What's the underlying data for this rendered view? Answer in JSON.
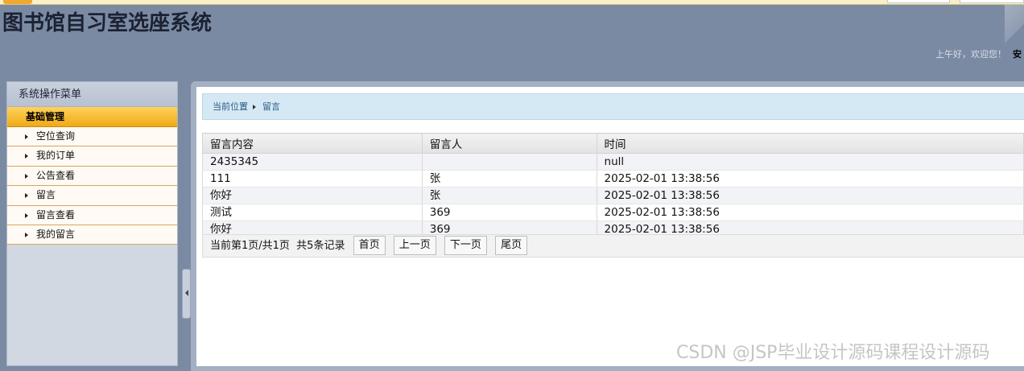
{
  "header": {
    "title": "图书馆自习室选座系统",
    "greeting": "上午好，欢迎您！",
    "user": "安"
  },
  "sidebar": {
    "title": "系统操作菜单",
    "group": "基础管理",
    "items": [
      {
        "label": "空位查询"
      },
      {
        "label": "我的订单"
      },
      {
        "label": "公告查看"
      },
      {
        "label": "留言"
      },
      {
        "label": "留言查看"
      },
      {
        "label": "我的留言"
      }
    ]
  },
  "breadcrumb": {
    "prefix": "当前位置",
    "current": "留言"
  },
  "table": {
    "headers": [
      "留言内容",
      "留言人",
      "时间"
    ],
    "rows": [
      [
        "2435345",
        "",
        "null"
      ],
      [
        "111",
        "张",
        "2025-02-01 13:38:56"
      ],
      [
        "你好",
        "张",
        "2025-02-01 13:38:56"
      ],
      [
        "测试",
        "369",
        "2025-02-01 13:38:56"
      ],
      [
        "你好",
        "369",
        "2025-02-01 13:38:56"
      ]
    ]
  },
  "pager": {
    "summary": "当前第1页/共1页  共5条记录",
    "first": "首页",
    "prev": "上一页",
    "next": "下一页",
    "last": "尾页"
  },
  "watermark": "CSDN @JSP毕业设计源码课程设计源码"
}
